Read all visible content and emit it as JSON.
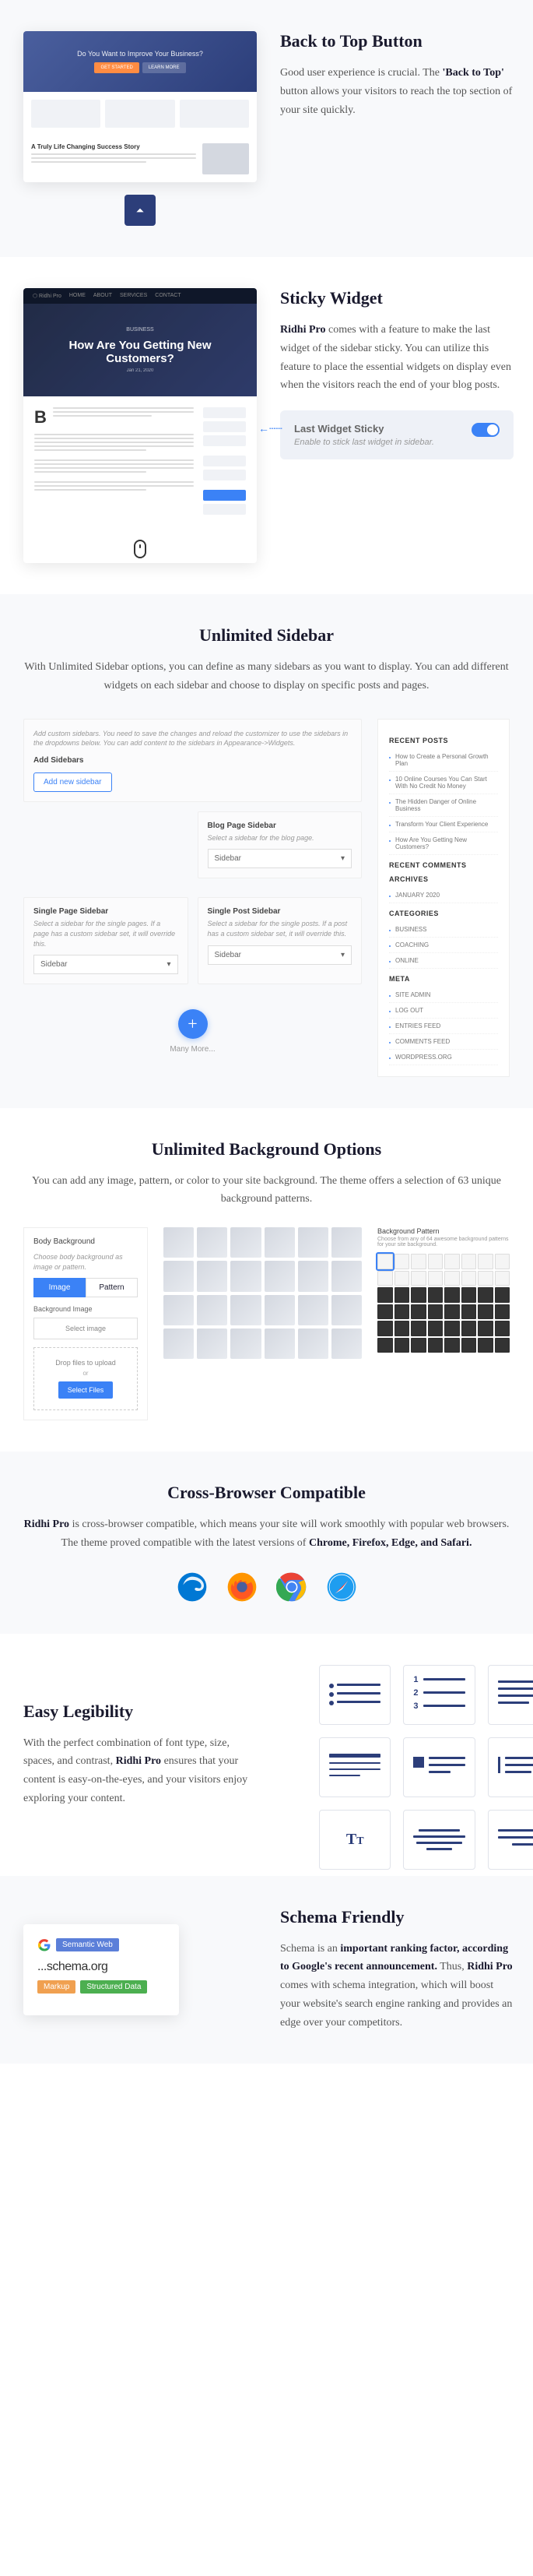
{
  "sections": {
    "backToTop": {
      "title": "Back to Top Button",
      "desc_pre": "Good user experience is crucial. The ",
      "desc_strong": "'Back to Top'",
      "desc_post": " button allows your visitors to reach the top section of your site quickly."
    },
    "stickyWidget": {
      "title": "Sticky Widget",
      "desc_strong": "Ridhi Pro",
      "desc_post": " comes with a feature to make the last widget of the sidebar sticky. You can utilize this feature to place the essential widgets on display even when the visitors reach the end of your blog posts.",
      "card_label": "Last Widget Sticky",
      "card_desc": "Enable to stick last widget in sidebar.",
      "blog_title": "How Are You Getting New Customers?"
    },
    "unlimitedSidebar": {
      "title": "Unlimited Sidebar",
      "desc": "With Unlimited Sidebar options, you can define as many sidebars as you want to display. You can add different widgets on each sidebar and choose to display on specific posts and pages.",
      "intro_text": "Add custom sidebars. You need to save the changes and reload the customizer to use the sidebars in the dropdowns below. You can add content to the sidebars in Appearance->Widgets.",
      "add_label": "Add Sidebars",
      "add_btn": "Add new sidebar",
      "cards": {
        "blogPage": {
          "title": "Blog Page Sidebar",
          "desc": "Select a sidebar for the blog page.",
          "value": "Sidebar"
        },
        "singlePage": {
          "title": "Single Page Sidebar",
          "desc": "Select a sidebar for the single pages. If a page has a custom sidebar set, it will override this.",
          "value": "Sidebar"
        },
        "singlePost": {
          "title": "Single Post Sidebar",
          "desc": "Select a sidebar for the single posts. If a post has a custom sidebar set, it will override this.",
          "value": "Sidebar"
        }
      },
      "manymore": "Many More...",
      "widgets": {
        "recent_posts_head": "RECENT POSTS",
        "recent_posts": [
          "How to Create a Personal Growth Plan",
          "10 Online Courses You Can Start With No Credit No Money",
          "The Hidden Danger of Online Business",
          "Transform Your Client Experience",
          "How Are You Getting New Customers?"
        ],
        "recent_comments_head": "RECENT COMMENTS",
        "archives_head": "ARCHIVES",
        "archives": [
          "JANUARY 2020"
        ],
        "categories_head": "CATEGORIES",
        "categories": [
          "BUSINESS",
          "COACHING",
          "ONLINE"
        ],
        "meta_head": "META",
        "meta": [
          "SITE ADMIN",
          "LOG OUT",
          "ENTRIES FEED",
          "COMMENTS FEED",
          "WORDPRESS.ORG"
        ]
      }
    },
    "bgOptions": {
      "title": "Unlimited Background Options",
      "desc": "You can add any image, pattern, or color to your site background. The theme offers a selection of 63 unique background patterns.",
      "panel_title": "Body Background",
      "panel_desc": "Choose body background as image or pattern.",
      "tab_image": "Image",
      "tab_pattern": "Pattern",
      "bg_image_label": "Background Image",
      "select_image": "Select image",
      "drop_text": "Drop files to upload",
      "or": "or",
      "select_files": "Select Files",
      "swatch_title": "Background Pattern",
      "swatch_desc": "Choose from any of 64 awesome background patterns for your site background."
    },
    "crossBrowser": {
      "title": "Cross-Browser Compatible",
      "desc_strong1": "Ridhi Pro",
      "desc_mid": " is cross-browser compatible, which means your site will work smoothly with popular web browsers. The theme proved compatible with the latest versions of ",
      "desc_strong2": "Chrome, Firefox, Edge, and Safari."
    },
    "legibility": {
      "title": "Easy Legibility",
      "desc_pre": "With the perfect combination of font type, size, spaces, and contrast, ",
      "desc_strong": "Ridhi Pro",
      "desc_post": " ensures that your content is easy-on-the-eyes, and your visitors enjoy exploring your content."
    },
    "schema": {
      "title": "Schema Friendly",
      "desc_pre": "Schema is an ",
      "desc_strong1": "important ranking factor, according to Google's recent announcement.",
      "desc_mid": " Thus, ",
      "desc_strong2": "Ridhi Pro",
      "desc_post": " comes with schema integration, which will boost your website's search engine ranking and provides an edge over your competitors.",
      "badge1": "Semantic Web",
      "text": "...schema.org",
      "badge2": "Markup",
      "badge3": "Structured Data"
    }
  }
}
